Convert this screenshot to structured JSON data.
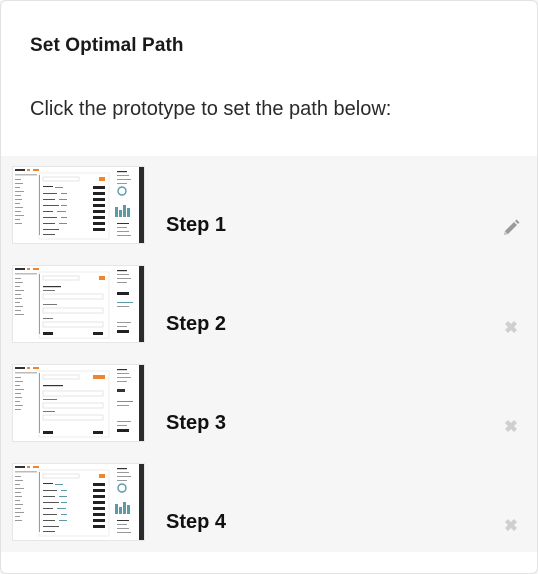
{
  "panel": {
    "title": "Set Optimal Path",
    "instructions": "Click the prototype to set the path below:"
  },
  "steps": [
    {
      "label": "Step 1",
      "action_icon": "pencil-icon",
      "thumbnail": "dashboard-chart"
    },
    {
      "label": "Step 2",
      "action_icon": "close-icon",
      "thumbnail": "form-page"
    },
    {
      "label": "Step 3",
      "action_icon": "close-icon",
      "thumbnail": "form-page"
    },
    {
      "label": "Step 4",
      "action_icon": "close-icon",
      "thumbnail": "dashboard-chart"
    }
  ],
  "colors": {
    "accent": "#f0852d",
    "icon_gray": "#9a9a9a",
    "steps_background": "#f6f6f6",
    "dark_sidebar": "#2b2b2b",
    "chart_teal": "#5b9aa6"
  }
}
